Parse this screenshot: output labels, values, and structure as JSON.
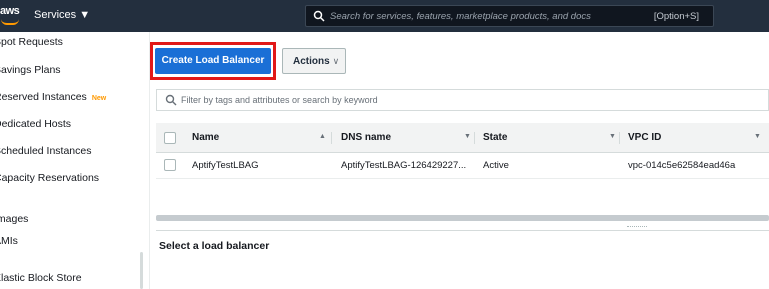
{
  "header": {
    "logo_text": "aws",
    "services_label": "Services ▼",
    "search_placeholder": "Search for services, features, marketplace products, and docs",
    "search_shortcut": "[Option+S]"
  },
  "sidebar": {
    "items": [
      {
        "label": "Spot Requests"
      },
      {
        "label": "Savings Plans"
      },
      {
        "label": "Reserved Instances",
        "badge": "New"
      },
      {
        "label": "Dedicated Hosts"
      },
      {
        "label": "Scheduled Instances"
      },
      {
        "label": "Capacity Reservations"
      },
      {
        "label": "Images"
      },
      {
        "label": "AMIs"
      },
      {
        "label": "Elastic Block Store"
      }
    ]
  },
  "toolbar": {
    "create_label": "Create Load Balancer",
    "actions_label": "Actions"
  },
  "filter": {
    "placeholder": "Filter by tags and attributes or search by keyword"
  },
  "table": {
    "columns": [
      "Name",
      "DNS name",
      "State",
      "VPC ID"
    ],
    "rows": [
      {
        "name": "AptifyTestLBAG",
        "dns": "AptifyTestLBAG-126429227...",
        "state": "Active",
        "vpc": "vpc-014c5e62584ead46a"
      }
    ]
  },
  "detail": {
    "title": "Select a load balancer"
  },
  "colors": {
    "nav_bg": "#232f3e",
    "primary_button": "#1a6fd6",
    "highlight_box": "#e11818",
    "new_badge": "#ff9900"
  }
}
